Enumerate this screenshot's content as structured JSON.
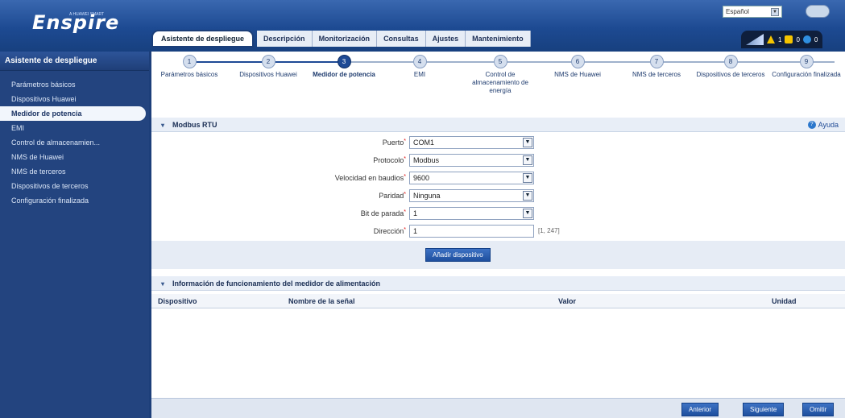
{
  "brand": {
    "logo": "Enspire",
    "logo_tagline": "A HUAWEI SMART"
  },
  "header": {
    "language": "Español",
    "tabs": [
      "Asistente de despliegue",
      "Descripción",
      "Monitorización",
      "Consultas",
      "Ajustes",
      "Mantenimiento"
    ],
    "alarms": {
      "major": "1",
      "minor": "0",
      "warning": "0"
    }
  },
  "sidebar": {
    "title": "Asistente de despliegue",
    "items": [
      "Parámetros básicos",
      "Dispositivos Huawei",
      "Medidor de potencia",
      "EMI",
      "Control de almacenamien...",
      "NMS de Huawei",
      "NMS de terceros",
      "Dispositivos de terceros",
      "Configuración finalizada"
    ]
  },
  "steps": [
    {
      "n": "1",
      "label": "Parámetros básicos"
    },
    {
      "n": "2",
      "label": "Dispositivos Huawei"
    },
    {
      "n": "3",
      "label": "Medidor de potencia"
    },
    {
      "n": "4",
      "label": "EMI"
    },
    {
      "n": "5",
      "label": "Control de almacenamiento de energía"
    },
    {
      "n": "6",
      "label": "NMS de Huawei"
    },
    {
      "n": "7",
      "label": "NMS de terceros"
    },
    {
      "n": "8",
      "label": "Dispositivos de terceros"
    },
    {
      "n": "9",
      "label": "Configuración finalizada"
    }
  ],
  "modbus": {
    "title": "Modbus RTU",
    "help": "Ayuda",
    "fields": {
      "puerto": {
        "label": "Puerto",
        "value": "COM1"
      },
      "protocolo": {
        "label": "Protocolo",
        "value": "Modbus"
      },
      "baudios": {
        "label": "Velocidad en baudios",
        "value": "9600"
      },
      "paridad": {
        "label": "Paridad",
        "value": "Ninguna"
      },
      "parada": {
        "label": "Bit de parada",
        "value": "1"
      },
      "direccion": {
        "label": "Dirección",
        "value": "1",
        "hint": "[1, 247]"
      }
    },
    "add_button": "Añadir dispositivo"
  },
  "info": {
    "title": "Información de funcionamiento del medidor de alimentación",
    "columns": [
      "Dispositivo",
      "Nombre de la señal",
      "Valor",
      "Unidad"
    ]
  },
  "footer": {
    "prev": "Anterior",
    "next": "Siguiente",
    "finish": "Omitir"
  }
}
